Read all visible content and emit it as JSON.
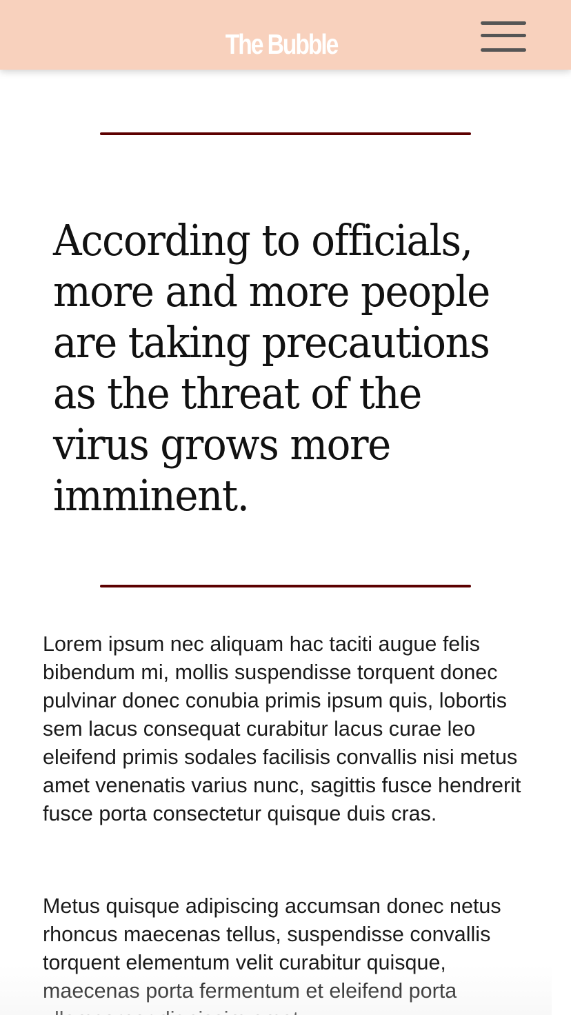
{
  "header": {
    "brand": "The Bubble",
    "background": "#f8d1bd",
    "menu_icon": "hamburger-menu-icon"
  },
  "article": {
    "pull_quote": "According to officials, more and more people are taking precautions as the threat of the virus grows more imminent.",
    "rule_color": "#5c0000",
    "paragraphs": [
      "Lorem ipsum nec aliquam hac taciti augue felis bibendum mi, mollis suspendisse torquent donec pulvinar donec conubia primis ipsum quis, lobortis sem lacus consequat curabitur lacus curae leo eleifend primis sodales facilisis convallis nisi metus amet venenatis varius nunc, sagittis fusce hendrerit fusce porta consectetur quisque duis cras.",
      "Metus quisque adipiscing accumsan donec netus rhoncus maecenas tellus, suspendisse convallis torquent elementum velit curabitur quisque, maecenas porta fermentum et eleifend porta ullamcorper dignissim amet"
    ]
  }
}
